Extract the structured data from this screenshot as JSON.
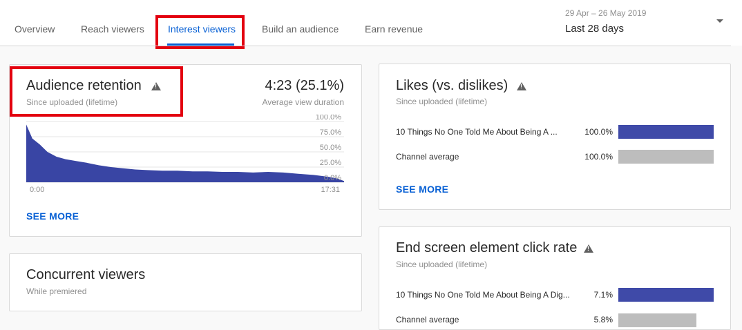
{
  "tabs": [
    {
      "label": "Overview",
      "active": false
    },
    {
      "label": "Reach viewers",
      "active": false
    },
    {
      "label": "Interest viewers",
      "active": true
    },
    {
      "label": "Build an audience",
      "active": false
    },
    {
      "label": "Earn revenue",
      "active": false
    }
  ],
  "date_picker": {
    "range": "29 Apr – 26 May 2019",
    "label": "Last 28 days"
  },
  "colors": {
    "accent": "#065fd4",
    "highlight": "#e3000f",
    "bar_video": "#3f4aa8",
    "bar_channel": "#bdbdbd",
    "retention_fill": "#3945a4"
  },
  "retention_card": {
    "title": "Audience retention",
    "subtitle": "Since uploaded (lifetime)",
    "value": "4:23 (25.1%)",
    "value_label": "Average view duration",
    "see_more": "SEE MORE",
    "chart_data": {
      "type": "area",
      "x_labels": [
        "0:00",
        "17:31"
      ],
      "y_ticks": [
        "100.0%",
        "75.0%",
        "50.0%",
        "25.0%",
        "0.0%"
      ],
      "ylim": [
        0,
        100
      ],
      "xlim_seconds": [
        0,
        1051
      ],
      "x_seconds": [
        0,
        20,
        45,
        70,
        100,
        130,
        165,
        200,
        240,
        280,
        320,
        360,
        400,
        450,
        500,
        550,
        600,
        650,
        700,
        750,
        800,
        850,
        900,
        950,
        1000,
        1030,
        1051
      ],
      "values": [
        95,
        72,
        62,
        50,
        42,
        38,
        35,
        32,
        28,
        25,
        23,
        21,
        20,
        19,
        19,
        18,
        18,
        17,
        17,
        16,
        17,
        16,
        14,
        12,
        9,
        6,
        2
      ]
    }
  },
  "concurrent_card": {
    "title": "Concurrent viewers",
    "subtitle": "While premiered"
  },
  "likes_card": {
    "title": "Likes (vs. dislikes)",
    "subtitle": "Since uploaded (lifetime)",
    "rows": [
      {
        "label": "10 Things No One Told Me About Being A ...",
        "pct_text": "100.0%",
        "value": 100.0,
        "type": "video"
      },
      {
        "label": "Channel average",
        "pct_text": "100.0%",
        "value": 100.0,
        "type": "channel"
      }
    ],
    "see_more": "SEE MORE"
  },
  "endscreen_card": {
    "title": "End screen element click rate",
    "subtitle": "Since uploaded (lifetime)",
    "rows": [
      {
        "label": "10 Things No One Told Me About Being A Dig...",
        "pct_text": "7.1%",
        "value": 7.1,
        "type": "video"
      },
      {
        "label": "Channel average",
        "pct_text": "5.8%",
        "value": 5.8,
        "type": "channel"
      }
    ]
  }
}
